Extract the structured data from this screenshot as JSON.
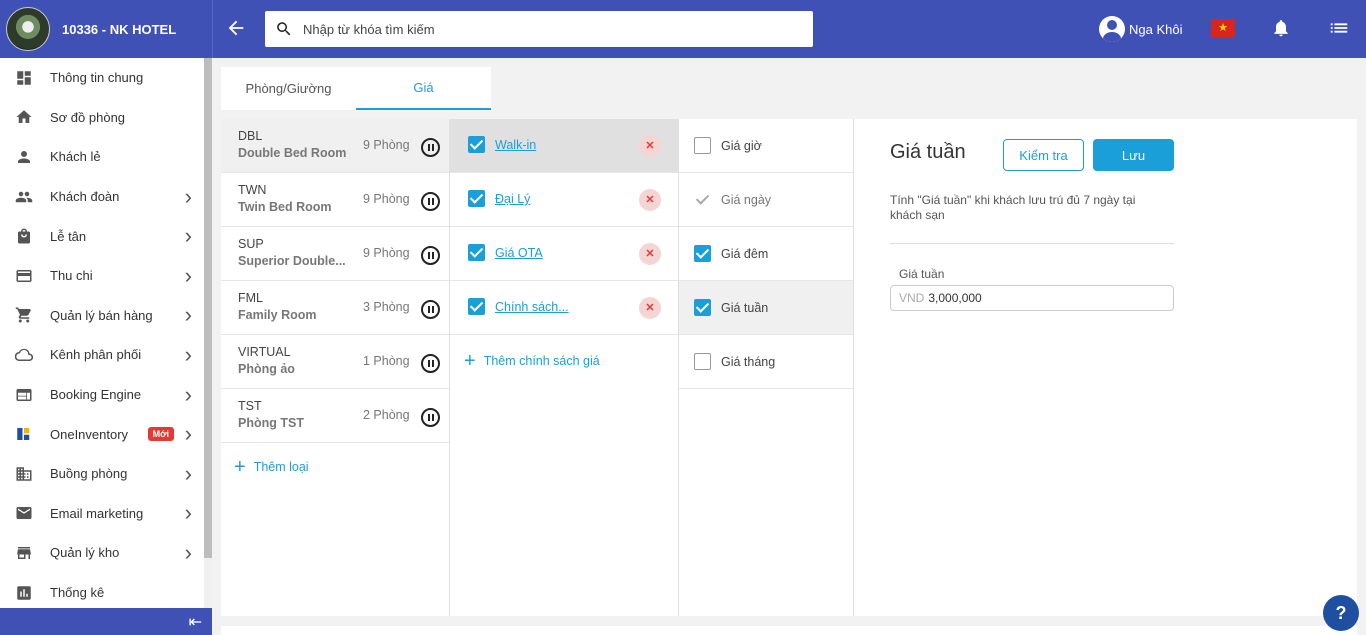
{
  "brand": {
    "name": "10336 - NK HOTEL"
  },
  "header": {
    "search_placeholder": "Nhập từ khóa tìm kiếm",
    "user_name": "Nga Khôi"
  },
  "sidebar": {
    "items": [
      {
        "label": "Thông tin chung",
        "icon": "dashboard-icon",
        "has_arrow": false
      },
      {
        "label": "Sơ đồ phòng",
        "icon": "home-icon",
        "has_arrow": false
      },
      {
        "label": "Khách lẻ",
        "icon": "person-icon",
        "has_arrow": false
      },
      {
        "label": "Khách đoàn",
        "icon": "group-icon",
        "has_arrow": true
      },
      {
        "label": "Lễ tân",
        "icon": "bag-icon",
        "has_arrow": true
      },
      {
        "label": "Thu chi",
        "icon": "card-icon",
        "has_arrow": true
      },
      {
        "label": "Quản lý bán hàng",
        "icon": "cart-icon",
        "has_arrow": true
      },
      {
        "label": "Kênh phân phối",
        "icon": "cloud-icon",
        "has_arrow": true
      },
      {
        "label": "Booking Engine",
        "icon": "browser-icon",
        "has_arrow": true
      },
      {
        "label": "OneInventory",
        "icon": "inventory-icon",
        "has_arrow": true,
        "badge": "Mới"
      },
      {
        "label": "Buồng phòng",
        "icon": "building-icon",
        "has_arrow": true
      },
      {
        "label": "Email marketing",
        "icon": "mail-icon",
        "has_arrow": true
      },
      {
        "label": "Quản lý kho",
        "icon": "store-icon",
        "has_arrow": true
      },
      {
        "label": "Thống kê",
        "icon": "chart-icon",
        "has_arrow": false
      }
    ]
  },
  "tabs": [
    {
      "label": "Phòng/Giường",
      "active": false
    },
    {
      "label": "Giá",
      "active": true
    }
  ],
  "rooms": [
    {
      "code": "DBL",
      "name": "Double Bed Room",
      "count": "9 Phòng"
    },
    {
      "code": "TWN",
      "name": "Twin Bed Room",
      "count": "9 Phòng"
    },
    {
      "code": "SUP",
      "name": "Superior Double...",
      "count": "9 Phòng"
    },
    {
      "code": "FML",
      "name": "Family Room",
      "count": "3 Phòng"
    },
    {
      "code": "VIRTUAL",
      "name": "Phòng ảo",
      "count": "1 Phòng"
    },
    {
      "code": "TST",
      "name": "Phòng TST",
      "count": "2 Phòng"
    }
  ],
  "add_room_type": "Thêm loại",
  "policies": [
    {
      "label": "Walk-in",
      "checked": true
    },
    {
      "label": "Đại Lý",
      "checked": true
    },
    {
      "label": "Giá OTA",
      "checked": true
    },
    {
      "label": "Chính sách...",
      "checked": true
    }
  ],
  "add_policy": "Thêm chính sách giá",
  "price_types": [
    {
      "label": "Giá giờ",
      "state": "unchecked"
    },
    {
      "label": "Giá ngày",
      "state": "disabled"
    },
    {
      "label": "Giá đêm",
      "state": "checked"
    },
    {
      "label": "Giá tuần",
      "state": "checked"
    },
    {
      "label": "Giá tháng",
      "state": "unchecked"
    }
  ],
  "detail": {
    "title": "Giá tuần",
    "check_label": "Kiểm tra",
    "save_label": "Lưu",
    "description": "Tính \"Giá tuần\" khi khách lưu trú đủ 7 ngày tại khách sạn",
    "field_label": "Giá tuần",
    "currency": "VND",
    "value": "3,000,000"
  },
  "help_label": "?",
  "colors": {
    "primary": "#3f51b5",
    "accent": "#1a9fd8",
    "danger": "#e53935"
  }
}
